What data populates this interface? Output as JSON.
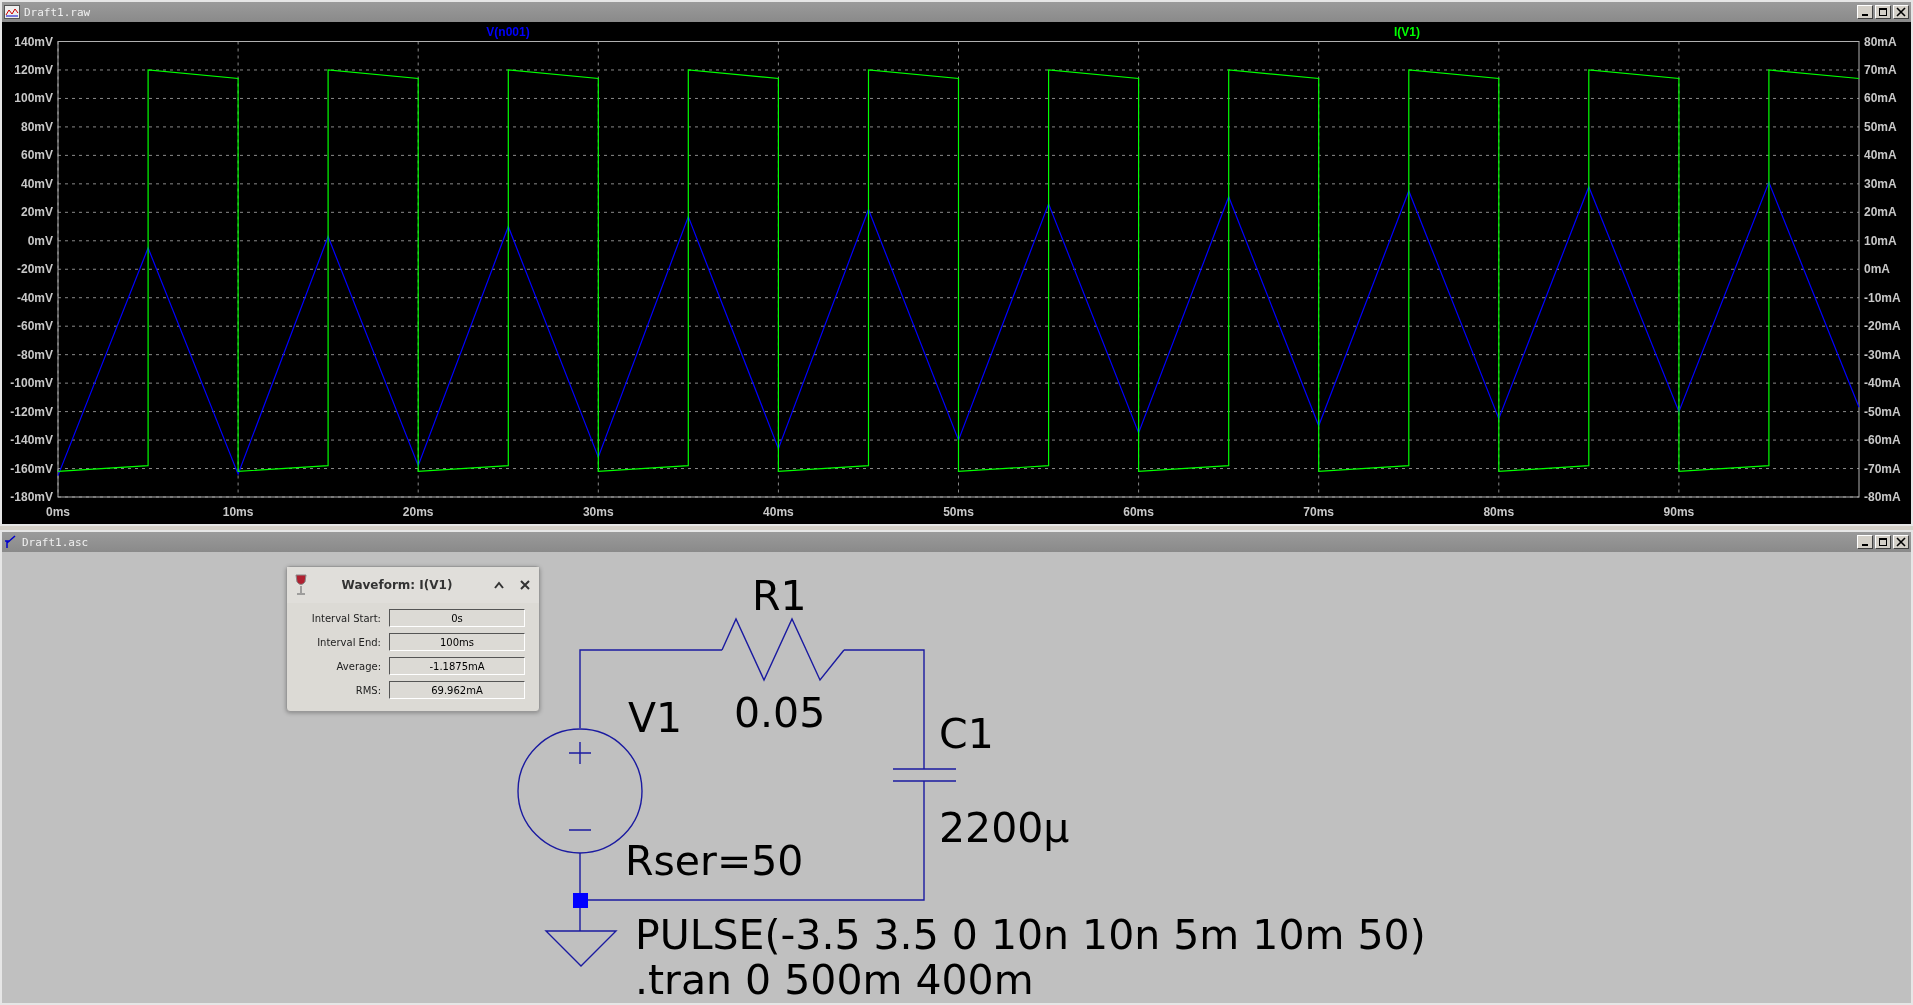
{
  "plot_window": {
    "title": "Draft1.raw",
    "chart_data": {
      "type": "line",
      "x": [
        0,
        5,
        5,
        10,
        10,
        15,
        15,
        20,
        20,
        25,
        25,
        30,
        30,
        35,
        35,
        40,
        40,
        45,
        45,
        50,
        50,
        55,
        55,
        60,
        60,
        65,
        65,
        70,
        70,
        75,
        75,
        80,
        80,
        85,
        85,
        90,
        90,
        95,
        95,
        100
      ],
      "series": [
        {
          "name": "V(n001)",
          "color": "#0000ff",
          "axis": "y",
          "values": [
            -165,
            -5,
            -5,
            -164,
            -164,
            3,
            3,
            -158,
            -158,
            10,
            10,
            -152,
            -152,
            17,
            17,
            -146,
            -146,
            22,
            22,
            -140,
            -140,
            26,
            26,
            -135,
            -135,
            31,
            31,
            -130,
            -130,
            35,
            35,
            -125,
            -125,
            38,
            38,
            -120,
            -120,
            41,
            41,
            -117
          ]
        },
        {
          "name": "I(V1)",
          "color": "#00ff00",
          "axis": "y2",
          "values": [
            -71,
            -69,
            70,
            67,
            -71,
            -69,
            70,
            67,
            -71,
            -69,
            70,
            67,
            -71,
            -69,
            70,
            67,
            -71,
            -69,
            70,
            67,
            -71,
            -69,
            70,
            67,
            -71,
            -69,
            70,
            67,
            -71,
            -69,
            70,
            67,
            -71,
            -69,
            70,
            67,
            -71,
            -69,
            70,
            67
          ]
        }
      ],
      "xlim": [
        0,
        100
      ],
      "grid": true,
      "ylim": [
        -180,
        140
      ],
      "y2lim": [
        -80,
        80
      ],
      "xticks": [
        {
          "value": 0,
          "label": "0ms"
        },
        {
          "value": 10,
          "label": "10ms"
        },
        {
          "value": 20,
          "label": "20ms"
        },
        {
          "value": 30,
          "label": "30ms"
        },
        {
          "value": 40,
          "label": "40ms"
        },
        {
          "value": 50,
          "label": "50ms"
        },
        {
          "value": 60,
          "label": "60ms"
        },
        {
          "value": 70,
          "label": "70ms"
        },
        {
          "value": 80,
          "label": "80ms"
        },
        {
          "value": 90,
          "label": "90ms"
        }
      ],
      "yticks": [
        {
          "value": 140,
          "label": "140mV"
        },
        {
          "value": 120,
          "label": "120mV"
        },
        {
          "value": 100,
          "label": "100mV"
        },
        {
          "value": 80,
          "label": "80mV"
        },
        {
          "value": 60,
          "label": "60mV"
        },
        {
          "value": 40,
          "label": "40mV"
        },
        {
          "value": 20,
          "label": "20mV"
        },
        {
          "value": 0,
          "label": "0mV"
        },
        {
          "value": -20,
          "label": "-20mV"
        },
        {
          "value": -40,
          "label": "-40mV"
        },
        {
          "value": -60,
          "label": "-60mV"
        },
        {
          "value": -80,
          "label": "-80mV"
        },
        {
          "value": -100,
          "label": "-100mV"
        },
        {
          "value": -120,
          "label": "-120mV"
        },
        {
          "value": -140,
          "label": "-140mV"
        },
        {
          "value": -160,
          "label": "-160mV"
        },
        {
          "value": -180,
          "label": "-180mV"
        }
      ],
      "y2ticks": [
        {
          "value": 80,
          "label": "80mA"
        },
        {
          "value": 70,
          "label": "70mA"
        },
        {
          "value": 60,
          "label": "60mA"
        },
        {
          "value": 50,
          "label": "50mA"
        },
        {
          "value": 40,
          "label": "40mA"
        },
        {
          "value": 30,
          "label": "30mA"
        },
        {
          "value": 20,
          "label": "20mA"
        },
        {
          "value": 10,
          "label": "10mA"
        },
        {
          "value": 0,
          "label": "0mA"
        },
        {
          "value": -10,
          "label": "-10mA"
        },
        {
          "value": -20,
          "label": "-20mA"
        },
        {
          "value": -30,
          "label": "-30mA"
        },
        {
          "value": -40,
          "label": "-40mA"
        },
        {
          "value": -50,
          "label": "-50mA"
        },
        {
          "value": -60,
          "label": "-60mA"
        },
        {
          "value": -70,
          "label": "-70mA"
        },
        {
          "value": -80,
          "label": "-80mA"
        }
      ]
    }
  },
  "schematic_window": {
    "title": "Draft1.asc",
    "components": [
      {
        "kind": "resistor",
        "name": "R1",
        "value": "0.05"
      },
      {
        "kind": "voltage_source",
        "name": "V1",
        "value": "Rser=50"
      },
      {
        "kind": "capacitor",
        "name": "C1",
        "value": "2200µ"
      }
    ],
    "directives": [
      "PULSE(-3.5 3.5 0 10n 10n 5m 10m 50)",
      ".tran 0 500m 400m"
    ]
  },
  "waveform_dialog": {
    "title": "Waveform: I(V1)",
    "fields": [
      {
        "label": "Interval Start:",
        "value": "0s"
      },
      {
        "label": "Interval End:",
        "value": "100ms"
      },
      {
        "label": "Average:",
        "value": "-1.1875mA"
      },
      {
        "label": "RMS:",
        "value": "69.962mA"
      }
    ]
  }
}
